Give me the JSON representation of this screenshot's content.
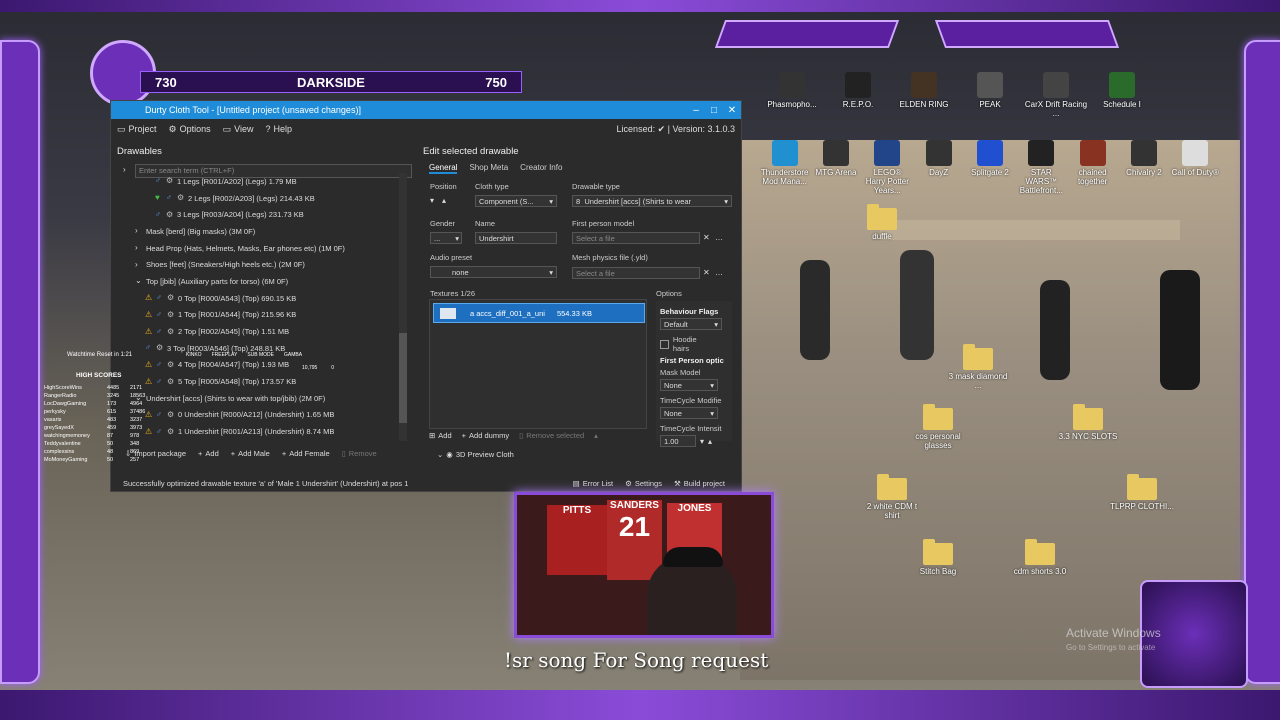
{
  "overlay": {
    "score_left": "730",
    "team": "DARKSIDE",
    "score_right": "750",
    "caption": "!sr song For Song request",
    "activate_title": "Activate Windows",
    "activate_sub": "Go to Settings to activate"
  },
  "desktop_icons": [
    {
      "label": "Phasmopho...",
      "color": "#333"
    },
    {
      "label": "R.E.P.O.",
      "color": "#222"
    },
    {
      "label": "ELDEN RING",
      "color": "#443322"
    },
    {
      "label": "PEAK",
      "color": "#555"
    },
    {
      "label": "CarX Drift Racing ...",
      "color": "#444"
    },
    {
      "label": "Schedule I",
      "color": "#2a6a2a"
    },
    {
      "label": "Thunderstore Mod Mana...",
      "color": "#2090d0"
    },
    {
      "label": "MTG Arena",
      "color": "#333"
    },
    {
      "label": "LEGO® Harry Potter Years...",
      "color": "#224488"
    },
    {
      "label": "DayZ",
      "color": "#333"
    },
    {
      "label": "Splitgate 2",
      "color": "#2050d0"
    },
    {
      "label": "STAR WARS™ Battlefront...",
      "color": "#222"
    },
    {
      "label": "chained together",
      "color": "#883322"
    },
    {
      "label": "Chivalry 2",
      "color": "#333"
    },
    {
      "label": "Call of Duty®",
      "color": "#ddd"
    },
    {
      "label": "duffle",
      "color": "#e8c860"
    },
    {
      "label": "3 mask diamond ...",
      "color": "#e8c860"
    },
    {
      "label": "cos personal glasses",
      "color": "#e8c860"
    },
    {
      "label": "3.3 NYC SLOTS",
      "color": "#e8c860"
    },
    {
      "label": "2 white CDM t shirt",
      "color": "#e8c860"
    },
    {
      "label": "TLPRP CLOTHI...",
      "color": "#e8c860"
    },
    {
      "label": "Stitch Bag",
      "color": "#e8c860"
    },
    {
      "label": "cdm shorts 3.0",
      "color": "#e8c860"
    }
  ],
  "app": {
    "title": "Durty Cloth Tool - [Untitled project (unsaved changes)]",
    "menu": [
      "Project",
      "Options",
      "View",
      "Help"
    ],
    "license": "Licensed: ✔ | Version: 3.1.0.3",
    "drawables_title": "Drawables",
    "search_placeholder": "Enter search term (CTRL+F)",
    "tree": [
      {
        "indent": 3,
        "icons": "male",
        "text": "1 Legs [R001/A202] (Legs) 1.79 MB"
      },
      {
        "indent": 3,
        "icons": "green-male",
        "text": "2 Legs [R002/A203] (Legs) 214.43 KB"
      },
      {
        "indent": 3,
        "icons": "male",
        "text": "3 Legs [R003/A204] (Legs) 231.73 KB"
      },
      {
        "indent": 1,
        "icons": "caret",
        "text": "Mask [berd] (Big masks) (3M 0F)"
      },
      {
        "indent": 1,
        "icons": "caret",
        "text": "Head Prop (Hats, Helmets, Masks, Ear phones etc) (1M 0F)"
      },
      {
        "indent": 1,
        "icons": "caret",
        "text": "Shoes [feet] (Sneakers/High heels etc.) (2M 0F)"
      },
      {
        "indent": 1,
        "icons": "open",
        "text": "Top [jbib] (Auxiliary parts for torso) (6M 0F)"
      },
      {
        "indent": 2,
        "icons": "warn",
        "text": "0 Top [R000/A543] (Top) 690.15 KB"
      },
      {
        "indent": 2,
        "icons": "warn",
        "text": "1 Top [R001/A544] (Top) 215.96 KB"
      },
      {
        "indent": 2,
        "icons": "warn",
        "text": "2 Top [R002/A545] (Top) 1.51 MB"
      },
      {
        "indent": 2,
        "icons": "male",
        "text": "3 Top [R003/A546] (Top) 248.81 KB"
      },
      {
        "indent": 2,
        "icons": "warn",
        "text": "4 Top [R004/A547] (Top) 1.93 MB"
      },
      {
        "indent": 2,
        "icons": "warn",
        "text": "5 Top [R005/A548] (Top) 173.57 KB"
      },
      {
        "indent": 1,
        "icons": "open",
        "text": "Undershirt [accs] (Shirts to wear with top/jbib) (2M 0F)"
      },
      {
        "indent": 2,
        "icons": "warn",
        "text": "0 Undershirt [R000/A212] (Undershirt) 1.65 MB"
      },
      {
        "indent": 2,
        "icons": "warn",
        "text": "1 Undershirt [R001/A213] (Undershirt) 8.74 MB"
      }
    ],
    "left_buttons": [
      "Import package",
      "Add",
      "Add Male",
      "Add Female",
      "Remove"
    ],
    "edit_title": "Edit selected drawable",
    "tabs": [
      "General",
      "Shop Meta",
      "Creator Info"
    ],
    "fields": {
      "position_label": "Position",
      "cloth_type_label": "Cloth type",
      "cloth_type_value": "Component (S...",
      "drawable_type_label": "Drawable type",
      "drawable_type_num": "8",
      "drawable_type_value": "Undershirt [accs] (Shirts to wear",
      "gender_label": "Gender",
      "gender_value": "...",
      "name_label": "Name",
      "name_value": "Undershirt",
      "fp_model_label": "First person model",
      "fp_model_placeholder": "Select a file",
      "audio_label": "Audio preset",
      "audio_value": "none",
      "physics_label": "Mesh physics file (.yld)",
      "physics_placeholder": "Select a file"
    },
    "textures_title": "Textures 1/26",
    "texture_item": {
      "letter": "a",
      "name": "accs_diff_001_a_uni",
      "size": "554.33 KB"
    },
    "options_title": "Options",
    "options": {
      "behaviour_label": "Behaviour Flags",
      "behaviour_value": "Default",
      "hoodie_label": "Hoodie hairs",
      "fp_option_label": "First Person optic",
      "mask_label": "Mask Model",
      "mask_value": "None",
      "timecycle_label": "TimeCycle Modifie",
      "timecycle_value": "None",
      "intensity_label": "TimeCycle Intensit",
      "intensity_value": "1.00"
    },
    "tex_buttons": [
      "Add",
      "Add dummy",
      "Remove selected"
    ],
    "preview_label": "3D Preview Cloth",
    "status_text": "Successfully optimized drawable texture 'a' of 'Male 1 Undershirt' (Undershirt) at pos 1",
    "status_buttons": [
      "Error List",
      "Settings",
      "Build project"
    ]
  },
  "cam": {
    "jersey1": "PITTS",
    "jersey2": "SANDERS",
    "jersey2_num": "21",
    "jersey3": "JONES"
  },
  "leaderboard": {
    "title": "HIGH SCORES",
    "watchtime": "Watchtime Reset in 1:21",
    "rows": [
      [
        "HighScoreWins",
        "4485",
        "2171"
      ],
      [
        "RangerRadio",
        "3245",
        "18563"
      ],
      [
        "LocDawgGaming",
        "173",
        "4964"
      ],
      [
        "perkysky",
        "615",
        "37486"
      ],
      [
        "vasaris",
        "483",
        "3237"
      ],
      [
        "greySayedX",
        "459",
        "3973"
      ],
      [
        "watchingmemoney",
        "87",
        "978"
      ],
      [
        "Teddyvalentine",
        "50",
        "348"
      ],
      [
        "complexsins",
        "48",
        "869"
      ],
      [
        "MoMoneyGaming",
        "50",
        "257"
      ]
    ],
    "lucky_labels": [
      "KINKO",
      "FREEPLAY",
      "SUB MODE",
      "GAMBA"
    ],
    "lucky_values": [
      "10,795",
      "0"
    ]
  }
}
